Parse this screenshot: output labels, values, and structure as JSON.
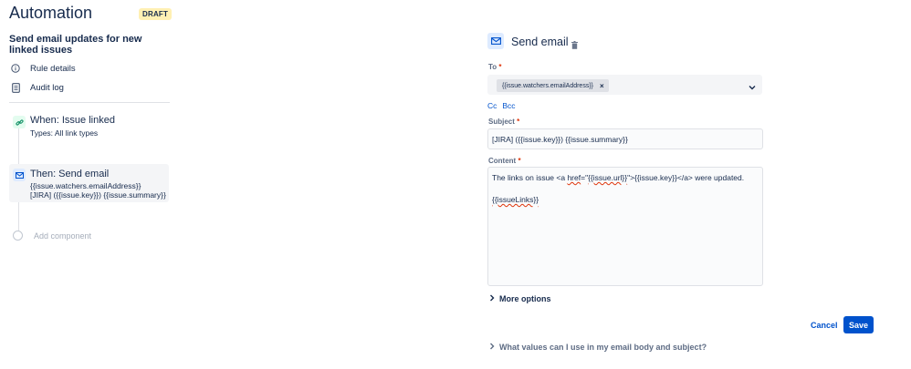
{
  "app": {
    "title": "Automation",
    "badge": "DRAFT"
  },
  "rule": {
    "name": "Send email updates for new linked issues"
  },
  "sidebar": {
    "links": [
      {
        "label": "Rule details",
        "icon": "info-icon"
      },
      {
        "label": "Audit log",
        "icon": "document-icon"
      }
    ]
  },
  "steps": {
    "trigger": {
      "title": "When: Issue linked",
      "sub": "Types: All link types",
      "icon": "link-icon",
      "color": "#e3fcef"
    },
    "action": {
      "title": "Then: Send email",
      "sub1": "{{issue.watchers.emailAddress}}",
      "sub2": "[JIRA] ({{issue.key}}) {{issue.summary}}",
      "icon": "mail-icon",
      "color": "#deebff"
    },
    "add_label": "Add component"
  },
  "panel": {
    "title": "Send email",
    "to_label": "To",
    "to_value": "{{issue.watchers.emailAddress}}",
    "cc": "Cc",
    "bcc": "Bcc",
    "subject_label": "Subject",
    "subject_value": "[JIRA] ({{issue.key}}) {{issue.summary}}",
    "content_label": "Content",
    "content": {
      "line1_pre": "The links on issue <a ",
      "line1_href": "href",
      "line1_eq": "=\"",
      "line1_url": "{{issue.url}}",
      "line1_post": "\">{{issue.key}}</a> were updated.",
      "line2": "{{issueLinks}}"
    },
    "required_mark": "*",
    "more_options": "More options",
    "cancel": "Cancel",
    "save": "Save",
    "help": "What values can I use in my email body and subject?"
  },
  "colors": {
    "accent": "#0052cc",
    "required": "#de350b",
    "text": "#172b4d"
  }
}
